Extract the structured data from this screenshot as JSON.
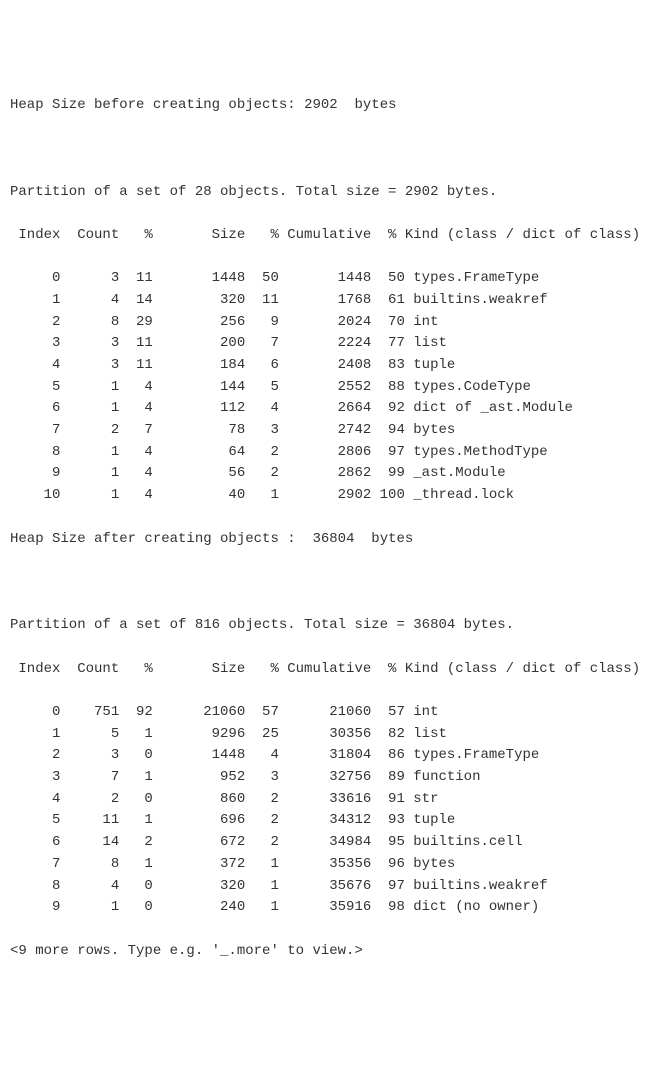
{
  "heap_before": {
    "label": "Heap Size before creating objects:",
    "value": "2902",
    "unit": "bytes"
  },
  "partition1": {
    "header": "Partition of a set of 28 objects. Total size = 2902 bytes.",
    "columns": " Index  Count   %       Size   % Cumulative  % Kind (class / dict of class)",
    "rows": [
      {
        "idx": "0",
        "count": "3",
        "cpct": "11",
        "size": "1448",
        "spct": "50",
        "cum": "1448",
        "cumpct": "50",
        "kind": "types.FrameType"
      },
      {
        "idx": "1",
        "count": "4",
        "cpct": "14",
        "size": "320",
        "spct": "11",
        "cum": "1768",
        "cumpct": "61",
        "kind": "builtins.weakref"
      },
      {
        "idx": "2",
        "count": "8",
        "cpct": "29",
        "size": "256",
        "spct": "9",
        "cum": "2024",
        "cumpct": "70",
        "kind": "int"
      },
      {
        "idx": "3",
        "count": "3",
        "cpct": "11",
        "size": "200",
        "spct": "7",
        "cum": "2224",
        "cumpct": "77",
        "kind": "list"
      },
      {
        "idx": "4",
        "count": "3",
        "cpct": "11",
        "size": "184",
        "spct": "6",
        "cum": "2408",
        "cumpct": "83",
        "kind": "tuple"
      },
      {
        "idx": "5",
        "count": "1",
        "cpct": "4",
        "size": "144",
        "spct": "5",
        "cum": "2552",
        "cumpct": "88",
        "kind": "types.CodeType"
      },
      {
        "idx": "6",
        "count": "1",
        "cpct": "4",
        "size": "112",
        "spct": "4",
        "cum": "2664",
        "cumpct": "92",
        "kind": "dict of _ast.Module"
      },
      {
        "idx": "7",
        "count": "2",
        "cpct": "7",
        "size": "78",
        "spct": "3",
        "cum": "2742",
        "cumpct": "94",
        "kind": "bytes"
      },
      {
        "idx": "8",
        "count": "1",
        "cpct": "4",
        "size": "64",
        "spct": "2",
        "cum": "2806",
        "cumpct": "97",
        "kind": "types.MethodType"
      },
      {
        "idx": "9",
        "count": "1",
        "cpct": "4",
        "size": "56",
        "spct": "2",
        "cum": "2862",
        "cumpct": "99",
        "kind": "_ast.Module"
      },
      {
        "idx": "10",
        "count": "1",
        "cpct": "4",
        "size": "40",
        "spct": "1",
        "cum": "2902",
        "cumpct": "100",
        "kind": "_thread.lock"
      }
    ]
  },
  "heap_after": {
    "label": "Heap Size after creating objects :",
    "value": "36804",
    "unit": "bytes"
  },
  "partition2": {
    "header": "Partition of a set of 816 objects. Total size = 36804 bytes.",
    "columns": " Index  Count   %       Size   % Cumulative  % Kind (class / dict of class)",
    "rows": [
      {
        "idx": "0",
        "count": "751",
        "cpct": "92",
        "size": "21060",
        "spct": "57",
        "cum": "21060",
        "cumpct": "57",
        "kind": "int"
      },
      {
        "idx": "1",
        "count": "5",
        "cpct": "1",
        "size": "9296",
        "spct": "25",
        "cum": "30356",
        "cumpct": "82",
        "kind": "list"
      },
      {
        "idx": "2",
        "count": "3",
        "cpct": "0",
        "size": "1448",
        "spct": "4",
        "cum": "31804",
        "cumpct": "86",
        "kind": "types.FrameType"
      },
      {
        "idx": "3",
        "count": "7",
        "cpct": "1",
        "size": "952",
        "spct": "3",
        "cum": "32756",
        "cumpct": "89",
        "kind": "function"
      },
      {
        "idx": "4",
        "count": "2",
        "cpct": "0",
        "size": "860",
        "spct": "2",
        "cum": "33616",
        "cumpct": "91",
        "kind": "str"
      },
      {
        "idx": "5",
        "count": "11",
        "cpct": "1",
        "size": "696",
        "spct": "2",
        "cum": "34312",
        "cumpct": "93",
        "kind": "tuple"
      },
      {
        "idx": "6",
        "count": "14",
        "cpct": "2",
        "size": "672",
        "spct": "2",
        "cum": "34984",
        "cumpct": "95",
        "kind": "builtins.cell"
      },
      {
        "idx": "7",
        "count": "8",
        "cpct": "1",
        "size": "372",
        "spct": "1",
        "cum": "35356",
        "cumpct": "96",
        "kind": "bytes"
      },
      {
        "idx": "8",
        "count": "4",
        "cpct": "0",
        "size": "320",
        "spct": "1",
        "cum": "35676",
        "cumpct": "97",
        "kind": "builtins.weakref"
      },
      {
        "idx": "9",
        "count": "1",
        "cpct": "0",
        "size": "240",
        "spct": "1",
        "cum": "35916",
        "cumpct": "98",
        "kind": "dict (no owner)"
      }
    ]
  },
  "footer": "<9 more rows. Type e.g. '_.more' to view.>",
  "chart_data": [
    {
      "type": "table",
      "title": "Heap partition before creating objects (2902 bytes, 28 objects)",
      "columns": [
        "Index",
        "Count",
        "%",
        "Size",
        "%",
        "Cumulative",
        "%",
        "Kind"
      ],
      "rows": [
        [
          0,
          3,
          11,
          1448,
          50,
          1448,
          50,
          "types.FrameType"
        ],
        [
          1,
          4,
          14,
          320,
          11,
          1768,
          61,
          "builtins.weakref"
        ],
        [
          2,
          8,
          29,
          256,
          9,
          2024,
          70,
          "int"
        ],
        [
          3,
          3,
          11,
          200,
          7,
          2224,
          77,
          "list"
        ],
        [
          4,
          3,
          11,
          184,
          6,
          2408,
          83,
          "tuple"
        ],
        [
          5,
          1,
          4,
          144,
          5,
          2552,
          88,
          "types.CodeType"
        ],
        [
          6,
          1,
          4,
          112,
          4,
          2664,
          92,
          "dict of _ast.Module"
        ],
        [
          7,
          2,
          7,
          78,
          3,
          2742,
          94,
          "bytes"
        ],
        [
          8,
          1,
          4,
          64,
          2,
          2806,
          97,
          "types.MethodType"
        ],
        [
          9,
          1,
          4,
          56,
          2,
          2862,
          99,
          "_ast.Module"
        ],
        [
          10,
          1,
          4,
          40,
          1,
          2902,
          100,
          "_thread.lock"
        ]
      ]
    },
    {
      "type": "table",
      "title": "Heap partition after creating objects (36804 bytes, 816 objects)",
      "columns": [
        "Index",
        "Count",
        "%",
        "Size",
        "%",
        "Cumulative",
        "%",
        "Kind"
      ],
      "rows": [
        [
          0,
          751,
          92,
          21060,
          57,
          21060,
          57,
          "int"
        ],
        [
          1,
          5,
          1,
          9296,
          25,
          30356,
          82,
          "list"
        ],
        [
          2,
          3,
          0,
          1448,
          4,
          31804,
          86,
          "types.FrameType"
        ],
        [
          3,
          7,
          1,
          952,
          3,
          32756,
          89,
          "function"
        ],
        [
          4,
          2,
          0,
          860,
          2,
          33616,
          91,
          "str"
        ],
        [
          5,
          11,
          1,
          696,
          2,
          34312,
          93,
          "tuple"
        ],
        [
          6,
          14,
          2,
          672,
          2,
          34984,
          95,
          "builtins.cell"
        ],
        [
          7,
          8,
          1,
          372,
          1,
          35356,
          96,
          "bytes"
        ],
        [
          8,
          4,
          0,
          320,
          1,
          35676,
          97,
          "builtins.weakref"
        ],
        [
          9,
          1,
          0,
          240,
          1,
          35916,
          98,
          "dict (no owner)"
        ]
      ]
    }
  ]
}
